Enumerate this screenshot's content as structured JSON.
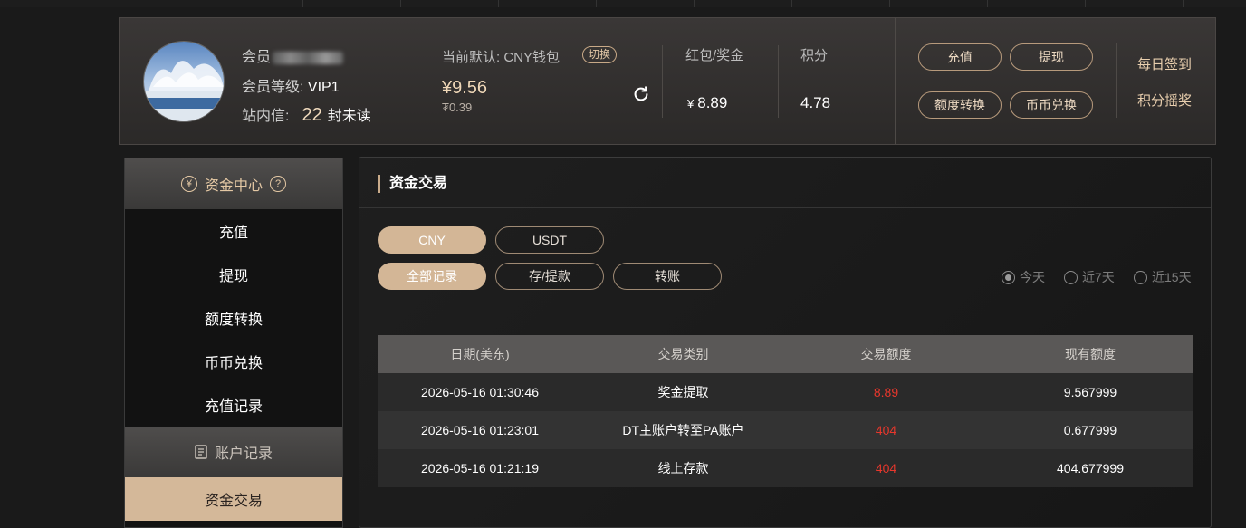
{
  "member": {
    "label": "会员",
    "level_label": "会员等级:",
    "level_value": "VIP1",
    "inbox_label": "站内信:",
    "inbox_count": "22",
    "inbox_suffix": "封未读"
  },
  "wallet": {
    "default_label": "当前默认: CNY钱包",
    "switch_label": "切换",
    "balance": "¥9.56",
    "sub_balance": "₮0.39",
    "refresh_icon": "refresh-icon"
  },
  "stats": {
    "bonus_label": "红包/奖金",
    "bonus_currency": "¥",
    "bonus_value": "8.89",
    "points_label": "积分",
    "points_value": "4.78"
  },
  "actions": {
    "deposit": "充值",
    "withdraw": "提现",
    "transfer": "额度转换",
    "exchange": "币币兑换",
    "daily_checkin": "每日签到",
    "points_lottery": "积分摇奖"
  },
  "sidebar": {
    "section_title": "资金中心",
    "items": [
      "充值",
      "提现",
      "额度转换",
      "币币兑换",
      "充值记录"
    ],
    "sub_section": "账户记录",
    "active_item": "资金交易"
  },
  "main": {
    "title": "资金交易",
    "currency_tabs": [
      "CNY",
      "USDT"
    ],
    "type_tabs": [
      "全部记录",
      "存/提款",
      "转账"
    ],
    "date_filters": [
      "今天",
      "近7天",
      "近15天"
    ]
  },
  "table": {
    "headers": [
      "日期(美东)",
      "交易类别",
      "交易额度",
      "现有额度"
    ],
    "rows": [
      [
        "2026-05-16 01:30:46",
        "奖金提取",
        "8.89",
        "9.567999"
      ],
      [
        "2026-05-16 01:23:01",
        "DT主账户转至PA账户",
        "404",
        "0.677999"
      ],
      [
        "2026-05-16 01:21:19",
        "线上存款",
        "404",
        "404.677999"
      ]
    ]
  },
  "colors": {
    "accent": "#d3b696",
    "negative": "#e8372c"
  }
}
